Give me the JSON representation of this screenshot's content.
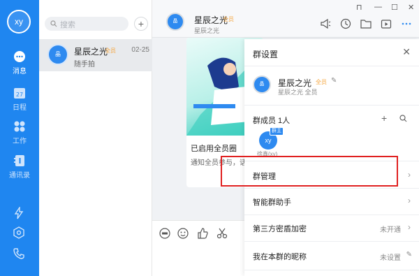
{
  "rail": {
    "avatar_text": "xy",
    "nav": [
      {
        "label": "消息",
        "icon": "message-icon"
      },
      {
        "label": "日程",
        "icon": "calendar-icon",
        "badge": "27"
      },
      {
        "label": "工作",
        "icon": "workbench-icon"
      },
      {
        "label": "通讯录",
        "icon": "contacts-icon"
      }
    ],
    "bottom_icons": [
      "lightning-icon",
      "hexagon-settings-icon",
      "phone-icon"
    ]
  },
  "conversation_list": {
    "search_placeholder": "搜索",
    "items": [
      {
        "avatar_text": "晶",
        "name": "星辰之光",
        "tag": "全员",
        "time": "02-25",
        "preview": "随手拍"
      }
    ]
  },
  "chat": {
    "header": {
      "avatar_text": "晶",
      "title": "星辰之光",
      "tag": "全员",
      "subtitle": "星辰之光"
    },
    "toolbar_icons": [
      "announcement-icon",
      "history-icon",
      "folder-icon",
      "video-icon",
      "more-icon"
    ],
    "card": {
      "title": "已启用全员圈",
      "subtitle": "通知全员参与，话"
    },
    "composer_icons": [
      "gif-icon",
      "emoji-icon",
      "thumbs-up-icon",
      "scissors-icon"
    ]
  },
  "panel": {
    "title": "群设置",
    "group": {
      "avatar_text": "晶",
      "name": "星辰之光",
      "tag": "全员",
      "subtitle": "星辰之光 全员"
    },
    "members": {
      "label": "群成员 1人",
      "member": {
        "avatar_text": "xy",
        "badge": "群主",
        "name": "徐鑫(xy)"
      }
    },
    "rows": [
      {
        "label": "群管理",
        "value": ""
      },
      {
        "label": "智能群助手",
        "value": ""
      },
      {
        "label": "第三方密盾加密",
        "value": "未开通"
      },
      {
        "label": "我在本群的昵称",
        "value": "未设置"
      }
    ]
  },
  "colors": {
    "rail": "#1f86f0",
    "accent_tag": "#f5a43b",
    "highlight": "#e02020"
  }
}
